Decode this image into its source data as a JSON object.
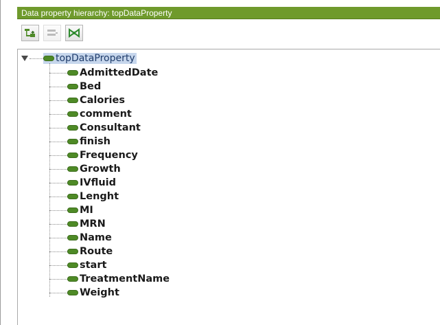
{
  "panel": {
    "title": "Data property hierarchy: topDataProperty"
  },
  "toolbar": {
    "buttons": [
      {
        "name": "add-subproperty",
        "icon": "add-subproperty-icon",
        "enabled": true
      },
      {
        "name": "add-sibling",
        "icon": "add-sibling-icon",
        "enabled": false
      },
      {
        "name": "delete",
        "icon": "delete-property-icon",
        "enabled": true
      }
    ]
  },
  "tree": {
    "root": {
      "label": "topDataProperty",
      "expanded": true,
      "selected": true
    },
    "children": [
      "AdmittedDate",
      "Bed",
      "Calories",
      "comment",
      "Consultant",
      "finish",
      "Frequency",
      "Growth",
      "IVfluid",
      "Lenght",
      "MI",
      "MRN",
      "Name",
      "Route",
      "start",
      "TreatmentName",
      "Weight"
    ]
  },
  "colors": {
    "title_bar": "#6f9a2c",
    "node_icon": "#4e8a26",
    "selection": "#c6d6ec"
  }
}
